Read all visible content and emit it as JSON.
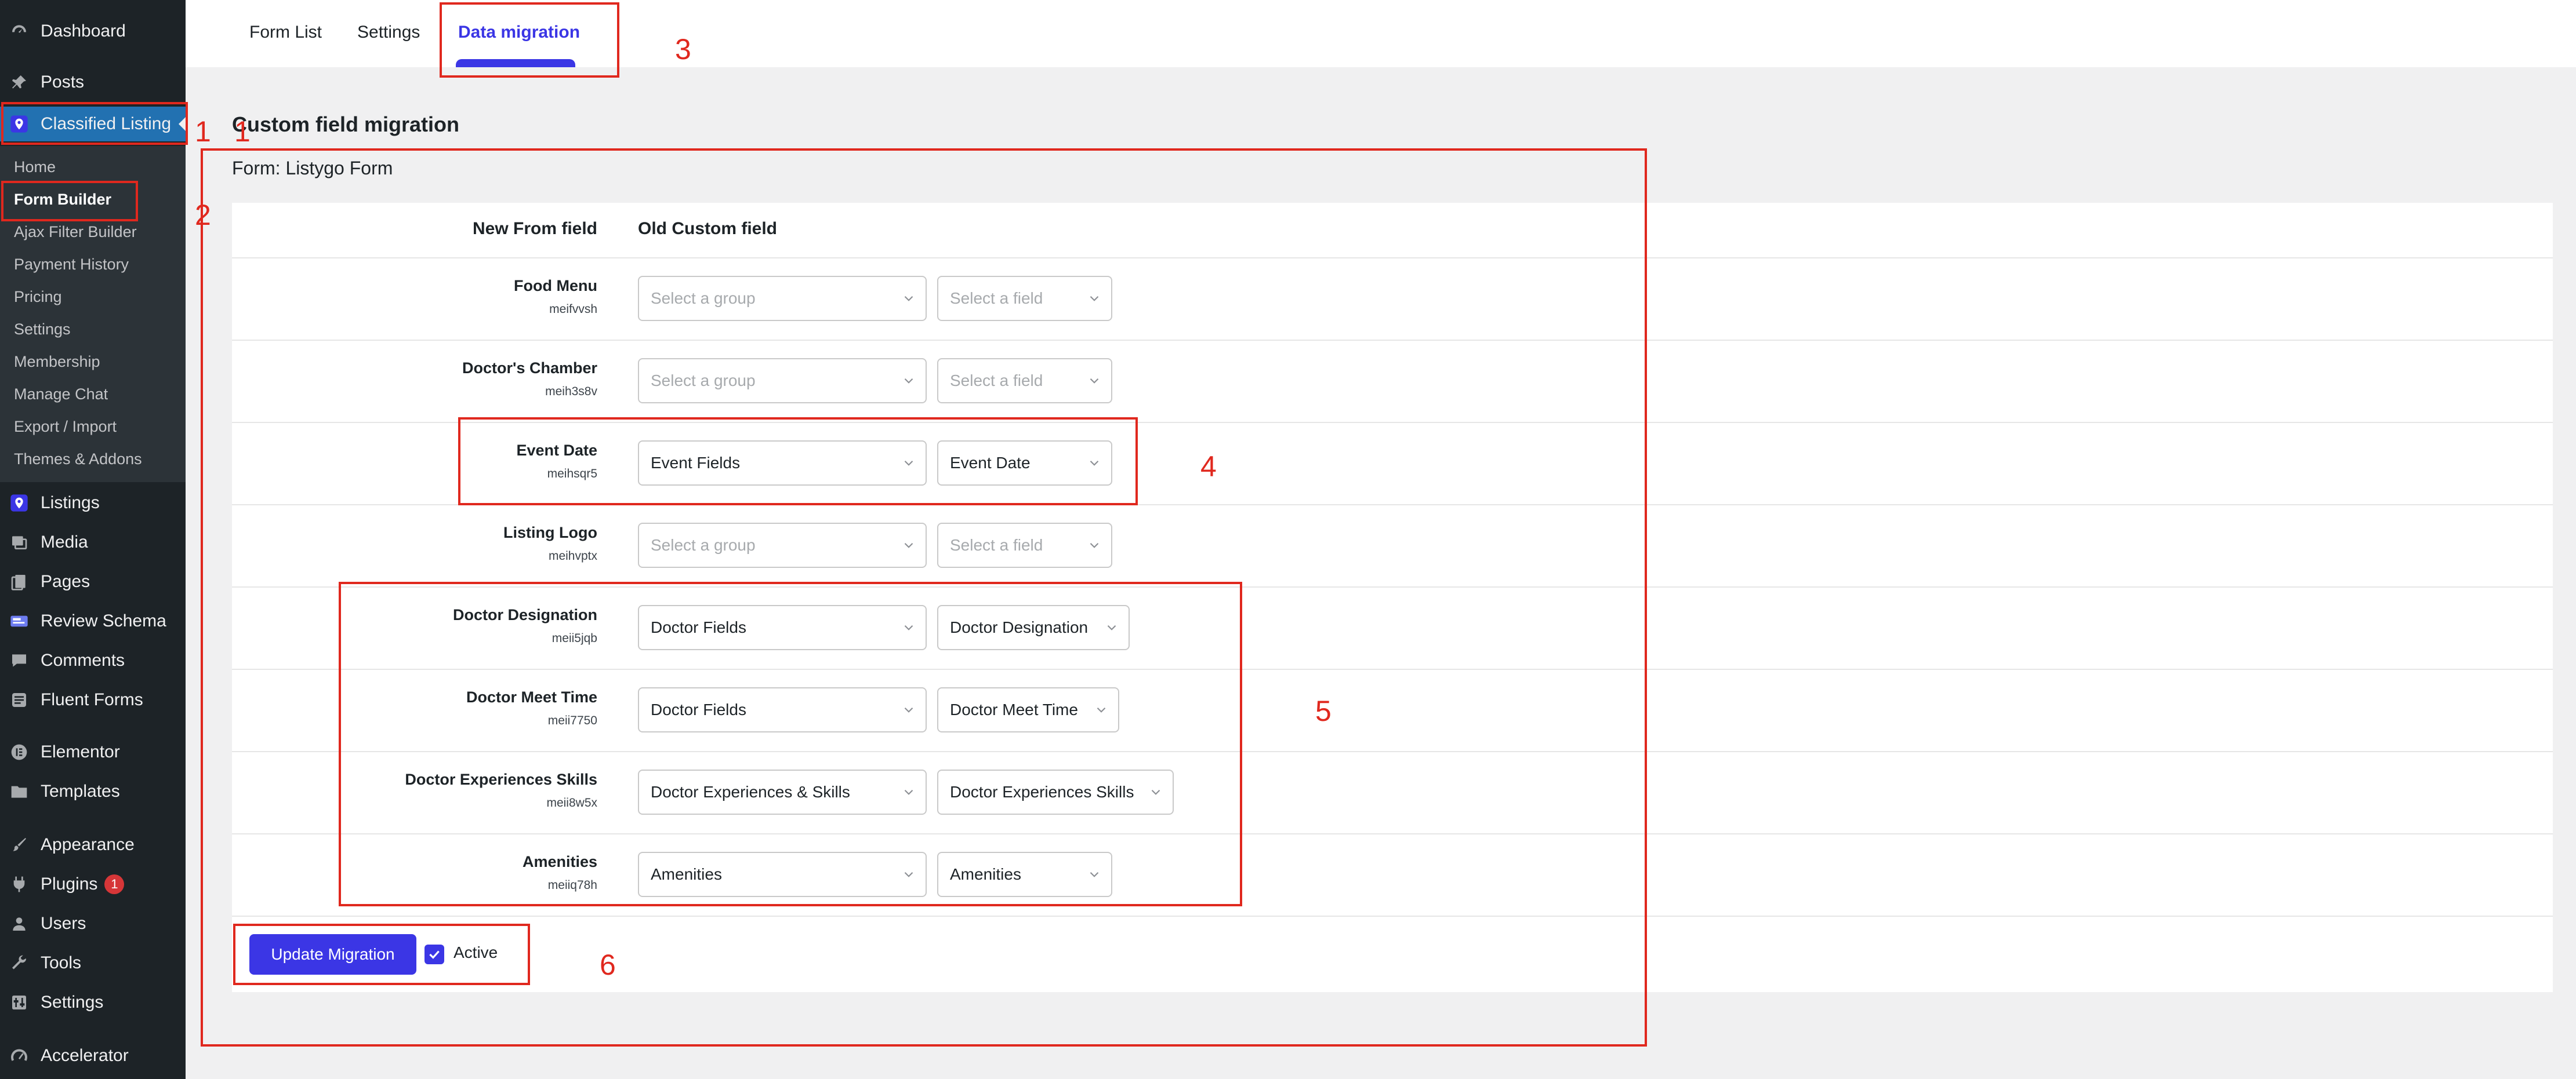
{
  "sidebar": {
    "items": [
      {
        "label": "Dashboard",
        "icon": "dashboard-icon"
      },
      {
        "label": "Posts",
        "icon": "pin-icon"
      },
      {
        "label": "Classified Listing",
        "icon": "location-pin-icon"
      },
      {
        "label": "Listings",
        "icon": "location-pin-icon"
      },
      {
        "label": "Media",
        "icon": "media-icon"
      },
      {
        "label": "Pages",
        "icon": "pages-icon"
      },
      {
        "label": "Review Schema",
        "icon": "review-schema-icon"
      },
      {
        "label": "Comments",
        "icon": "comment-icon"
      },
      {
        "label": "Fluent Forms",
        "icon": "forms-icon"
      },
      {
        "label": "Elementor",
        "icon": "elementor-icon"
      },
      {
        "label": "Templates",
        "icon": "folder-icon"
      },
      {
        "label": "Appearance",
        "icon": "brush-icon"
      },
      {
        "label": "Plugins",
        "icon": "plugin-icon",
        "badge": "1"
      },
      {
        "label": "Users",
        "icon": "user-icon"
      },
      {
        "label": "Tools",
        "icon": "wrench-icon"
      },
      {
        "label": "Settings",
        "icon": "settings-icon"
      },
      {
        "label": "Accelerator",
        "icon": "accelerator-icon"
      }
    ],
    "submenu": [
      "Home",
      "Form Builder",
      "Ajax Filter Builder",
      "Payment History",
      "Pricing",
      "Settings",
      "Membership",
      "Manage Chat",
      "Export / Import",
      "Themes & Addons"
    ]
  },
  "tabs": [
    "Form List",
    "Settings",
    "Data migration"
  ],
  "page": {
    "title": "Custom field migration",
    "form_name": "Form: Listygo Form"
  },
  "table": {
    "headers": [
      "New From field",
      "Old Custom field"
    ],
    "rows": [
      {
        "label": "Food Menu",
        "key": "meifvvsh",
        "group": "Select a group",
        "field": "Select a field",
        "empty": true
      },
      {
        "label": "Doctor's Chamber",
        "key": "meih3s8v",
        "group": "Select a group",
        "field": "Select a field",
        "empty": true
      },
      {
        "label": "Event Date",
        "key": "meihsqr5",
        "group": "Event Fields",
        "field": "Event Date",
        "empty": false
      },
      {
        "label": "Listing Logo",
        "key": "meihvptx",
        "group": "Select a group",
        "field": "Select a field",
        "empty": true
      },
      {
        "label": "Doctor Designation",
        "key": "meii5jqb",
        "group": "Doctor Fields",
        "field": "Doctor Designation",
        "empty": false
      },
      {
        "label": "Doctor Meet Time",
        "key": "meii7750",
        "group": "Doctor Fields",
        "field": "Doctor Meet Time",
        "empty": false
      },
      {
        "label": "Doctor Experiences Skills",
        "key": "meii8w5x",
        "group": "Doctor Experiences & Skills",
        "field": "Doctor Experiences Skills",
        "empty": false
      },
      {
        "label": "Amenities",
        "key": "meiiq78h",
        "group": "Amenities",
        "field": "Amenities",
        "empty": false
      }
    ]
  },
  "footer": {
    "update_button": "Update Migration",
    "active_label": "Active",
    "active_checked": true
  },
  "annotations": [
    "1",
    "1",
    "2",
    "3",
    "4",
    "5",
    "6"
  ],
  "colors": {
    "accent": "#3b36e5",
    "sidebar_bg": "#1d2327",
    "active_menu": "#2271b1",
    "annotation": "#e0281e"
  }
}
